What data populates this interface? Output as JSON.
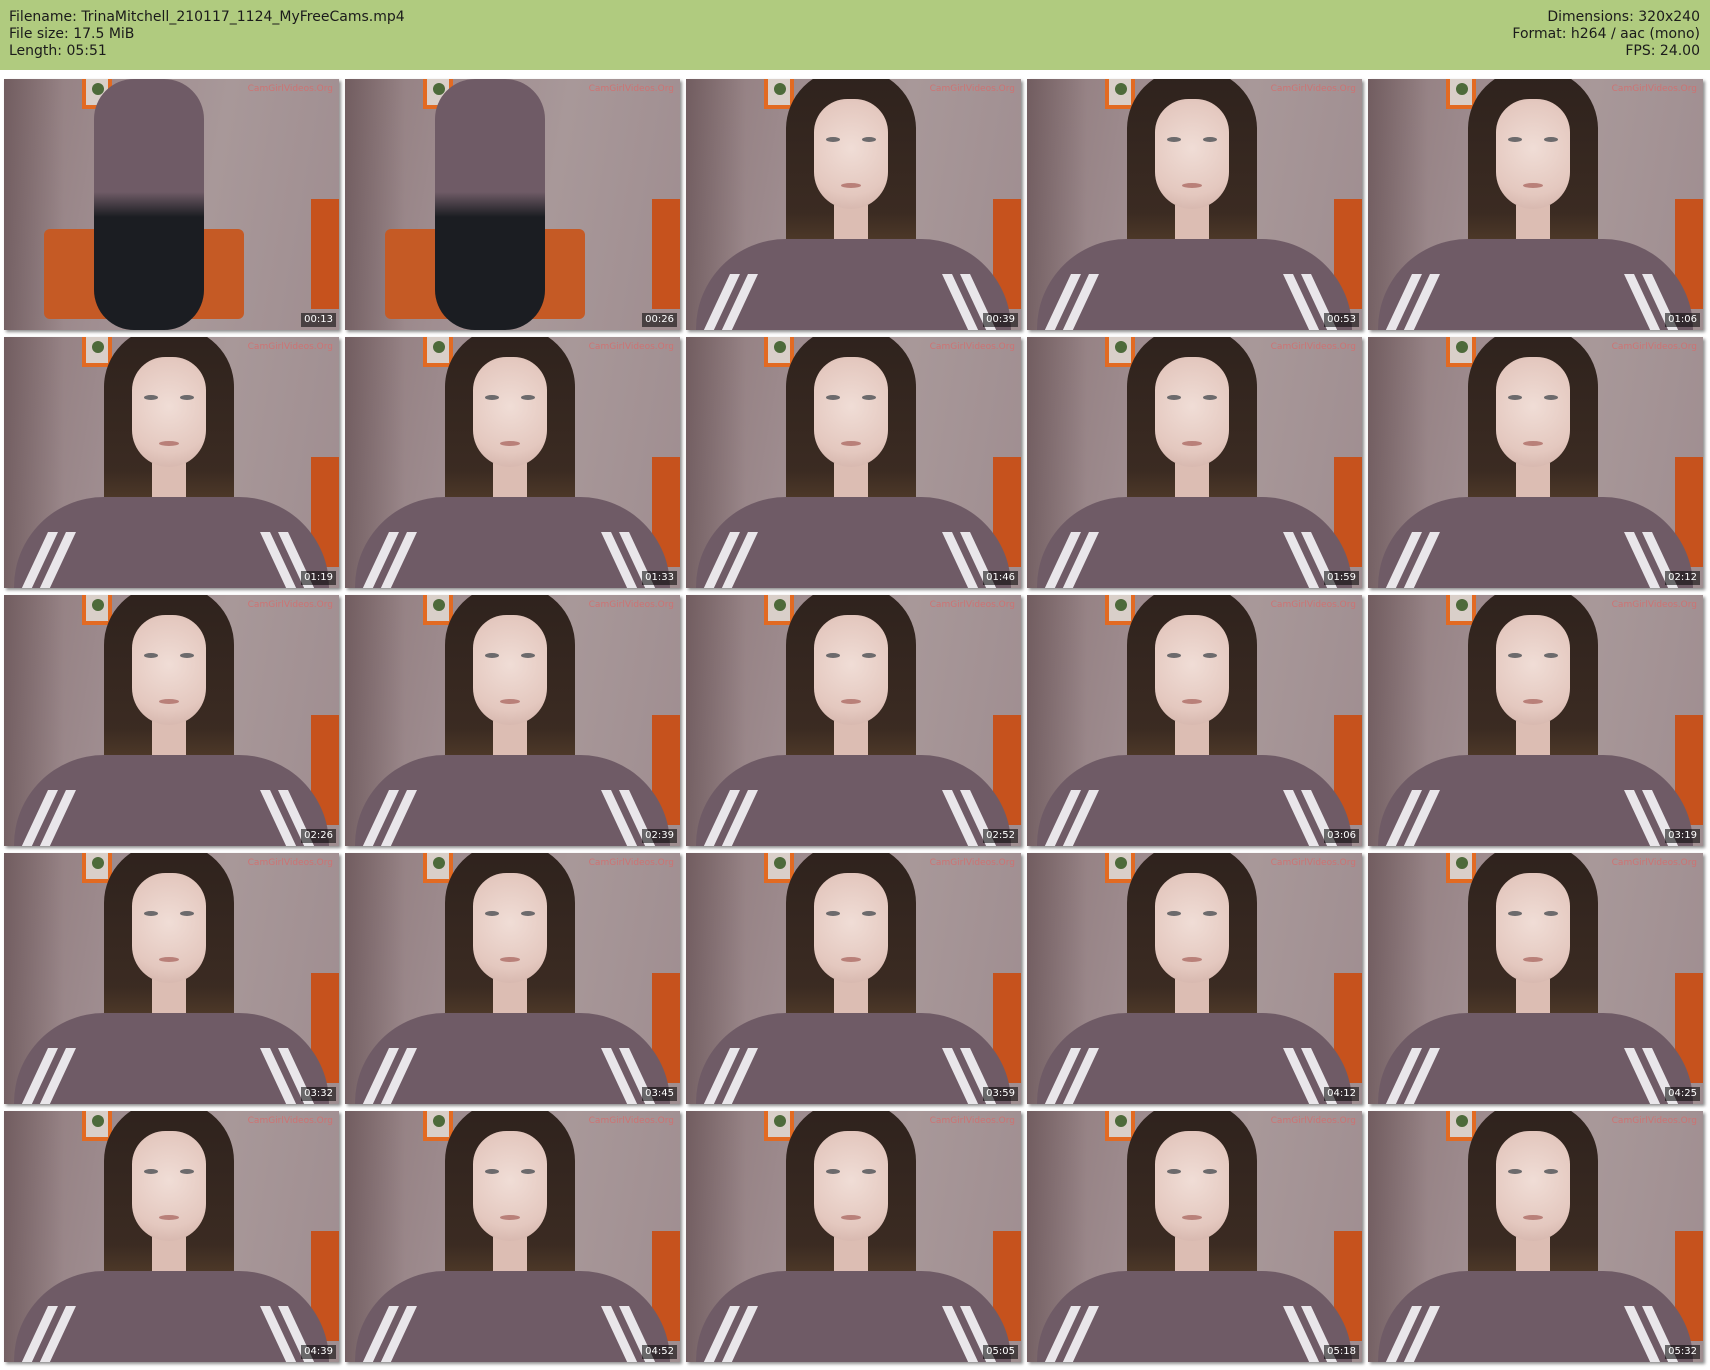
{
  "header": {
    "filename_label": "Filename:",
    "filename": "TrinaMitchell_210117_1124_MyFreeCams.mp4",
    "filesize_label": "File size:",
    "filesize": "17.5 MiB",
    "length_label": "Length:",
    "length": "05:51",
    "dimensions_label": "Dimensions:",
    "dimensions": "320x240",
    "format_label": "Format:",
    "format": "h264 / aac (mono)",
    "fps_label": "FPS:",
    "fps": "24.00"
  },
  "colors": {
    "header_bg": "#b0cb7f",
    "timestamp_bg": "#000000",
    "timestamp_text": "#ffffff"
  },
  "thumbnails": [
    {
      "time": "00:13",
      "watermark": "CamGirlVideos.Org"
    },
    {
      "time": "00:26",
      "watermark": "CamGirlVideos.Org"
    },
    {
      "time": "00:39",
      "watermark": "CamGirlVideos.Org"
    },
    {
      "time": "00:53",
      "watermark": "CamGirlVideos.Org"
    },
    {
      "time": "01:06",
      "watermark": "CamGirlVideos.Org"
    },
    {
      "time": "01:19",
      "watermark": "CamGirlVideos.Org"
    },
    {
      "time": "01:33",
      "watermark": "CamGirlVideos.Org"
    },
    {
      "time": "01:46",
      "watermark": "CamGirlVideos.Org"
    },
    {
      "time": "01:59",
      "watermark": "CamGirlVideos.Org"
    },
    {
      "time": "02:12",
      "watermark": "CamGirlVideos.Org"
    },
    {
      "time": "02:26",
      "watermark": "CamGirlVideos.Org"
    },
    {
      "time": "02:39",
      "watermark": "CamGirlVideos.Org"
    },
    {
      "time": "02:52",
      "watermark": "CamGirlVideos.Org"
    },
    {
      "time": "03:06",
      "watermark": "CamGirlVideos.Org"
    },
    {
      "time": "03:19",
      "watermark": "CamGirlVideos.Org"
    },
    {
      "time": "03:32",
      "watermark": "CamGirlVideos.Org"
    },
    {
      "time": "03:45",
      "watermark": "CamGirlVideos.Org"
    },
    {
      "time": "03:59",
      "watermark": "CamGirlVideos.Org"
    },
    {
      "time": "04:12",
      "watermark": "CamGirlVideos.Org"
    },
    {
      "time": "04:25",
      "watermark": "CamGirlVideos.Org"
    },
    {
      "time": "04:39",
      "watermark": "CamGirlVideos.Org"
    },
    {
      "time": "04:52",
      "watermark": "CamGirlVideos.Org"
    },
    {
      "time": "05:05",
      "watermark": "CamGirlVideos.Org"
    },
    {
      "time": "05:18",
      "watermark": "CamGirlVideos.Org"
    },
    {
      "time": "05:32",
      "watermark": "CamGirlVideos.Org"
    }
  ]
}
